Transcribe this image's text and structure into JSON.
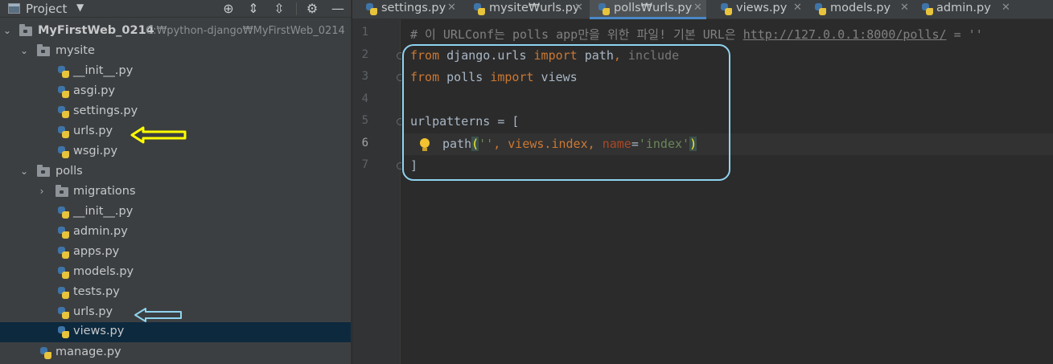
{
  "project_panel": {
    "title": "Project",
    "tree": {
      "root": {
        "label": "MyFirstWeb_0214",
        "path": "C:₩python-django₩MyFirstWeb_0214"
      },
      "mysite": {
        "label": "mysite",
        "files": [
          "__init__.py",
          "asgi.py",
          "settings.py",
          "urls.py",
          "wsgi.py"
        ]
      },
      "polls": {
        "label": "polls",
        "migrations": "migrations",
        "files": [
          "__init__.py",
          "admin.py",
          "apps.py",
          "models.py",
          "tests.py",
          "urls.py",
          "views.py"
        ]
      },
      "manage": "manage.py"
    }
  },
  "tabs": [
    {
      "label": "settings.py"
    },
    {
      "label": "mysite₩urls.py"
    },
    {
      "label": "polls₩urls.py"
    },
    {
      "label": "views.py"
    },
    {
      "label": "models.py"
    },
    {
      "label": "admin.py"
    }
  ],
  "editor": {
    "line_numbers": [
      "1",
      "2",
      "3",
      "4",
      "5",
      "6",
      "7"
    ],
    "line1_comment": "# 이 URLConf는 polls app만을 위한 파일! 기본 URL은 ",
    "line1_url": "http://127.0.0.1:8000/polls/",
    "line1_tail": " = ''",
    "line2": {
      "kw1": "from",
      "mod": " django.urls ",
      "kw2": "import",
      "names": " path",
      "sep": ",",
      "unused": " include"
    },
    "line3": {
      "kw1": "from",
      "mod": " polls ",
      "kw2": "import",
      "names": " views"
    },
    "line5": "urlpatterns = [",
    "line6": {
      "fn": "path",
      "open": "(",
      "str1": "''",
      "sep1": ", views.index, ",
      "kw": "name",
      "eq": "=",
      "str2": "'index'",
      "close": ")"
    },
    "line7": "]"
  },
  "colors": {
    "accent_tab": "#4a88c7",
    "annotation_yellow": "#ffff00",
    "annotation_blue": "#8fd3f0",
    "selected_row": "#0d293e"
  }
}
